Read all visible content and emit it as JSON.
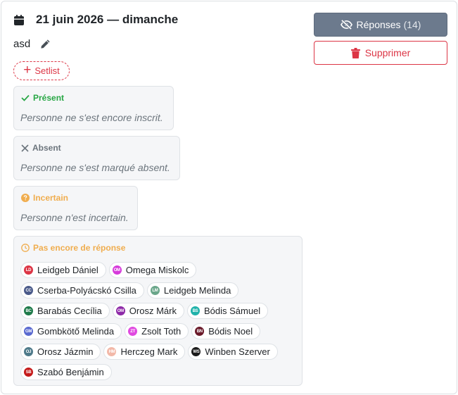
{
  "header": {
    "date": "21 juin 2026 — dimanche",
    "subtitle": "asd",
    "setlist_label": "Setlist",
    "responses_label": "Réponses",
    "responses_count": "(14)",
    "delete_label": "Supprimer"
  },
  "groups": {
    "present": {
      "title": "Présent",
      "empty": "Personne ne s'est encore inscrit.",
      "color": "#28a745"
    },
    "absent": {
      "title": "Absent",
      "empty": "Personne ne s'est marqué absent.",
      "color": "#6c757d"
    },
    "incertain": {
      "title": "Incertain",
      "empty": "Personne n'est incertain.",
      "color": "#f0ad4e"
    },
    "pending": {
      "title": "Pas encore de réponse",
      "color": "#f0ad4e",
      "people": [
        {
          "initials": "LD",
          "name": "Leidgeb Dániel",
          "color": "#dc3545"
        },
        {
          "initials": "OM",
          "name": "Omega Miskolc",
          "color": "#d63adb"
        },
        {
          "initials": "CC",
          "name": "Cserba-Polyácskó Csilla",
          "color": "#4a5a8a"
        },
        {
          "initials": "LM",
          "name": "Leidgeb Melinda",
          "color": "#6aa68a"
        },
        {
          "initials": "BC",
          "name": "Barabás Cecília",
          "color": "#1e7a4a"
        },
        {
          "initials": "OM",
          "name": "Orosz Márk",
          "color": "#8e2aa8"
        },
        {
          "initials": "BS",
          "name": "Bódis Sámuel",
          "color": "#20b2aa"
        },
        {
          "initials": "GM",
          "name": "Gombkötő Melinda",
          "color": "#5a6ad0"
        },
        {
          "initials": "ZT",
          "name": "Zsolt Toth",
          "color": "#e04ae0"
        },
        {
          "initials": "BN",
          "name": "Bódis Noel",
          "color": "#6a1a2a"
        },
        {
          "initials": "OJ",
          "name": "Orosz Jázmin",
          "color": "#4e7a8a"
        },
        {
          "initials": "HM",
          "name": "Herczeg Mark",
          "color": "#f2b8a8"
        },
        {
          "initials": "WS",
          "name": "Winben Szerver",
          "color": "#1a1a1a"
        },
        {
          "initials": "SB",
          "name": "Szabó Benjámin",
          "color": "#c41a1a"
        }
      ]
    }
  },
  "icons": {
    "calendar": "calendar-icon",
    "edit": "pencil-icon",
    "responses": "eye-slash-icon",
    "delete": "trash-icon",
    "present": "check-icon",
    "absent": "x-icon",
    "incertain": "question-circle-icon",
    "pending": "clock-icon"
  }
}
